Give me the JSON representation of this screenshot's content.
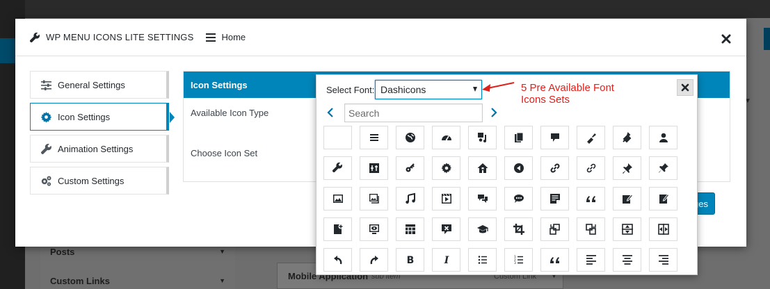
{
  "modal": {
    "title": "WP MENU ICONS LITE SETTINGS",
    "home_label": "Home"
  },
  "tabs": [
    {
      "label": "General Settings",
      "icon": "sliders-icon"
    },
    {
      "label": "Icon Settings",
      "icon": "gear-icon",
      "active": true
    },
    {
      "label": "Animation Settings",
      "icon": "wrench-icon"
    },
    {
      "label": "Custom Settings",
      "icon": "gears-icon"
    }
  ],
  "panel": {
    "title": "Icon Settings",
    "available_icon_type": "Available Icon Type",
    "choose_icon_set": "Choose Icon Set",
    "save_label": "Save Changes"
  },
  "picker": {
    "font_label": "Select Font:",
    "font_value": "Dashicons",
    "search_placeholder": "Search",
    "icons": [
      "blank",
      "menu-icon",
      "admin-site-icon",
      "dashboard-icon",
      "admin-media-icon",
      "admin-page-icon",
      "admin-comments-icon",
      "admin-appearance-icon",
      "admin-plugins-icon",
      "admin-users-icon",
      "admin-tools-icon",
      "admin-settings-icon",
      "admin-network-icon",
      "admin-generic-icon",
      "admin-home-icon",
      "admin-collapse-icon",
      "admin-links-icon",
      "format-links-icon",
      "admin-post-icon",
      "pin-icon",
      "format-image-icon",
      "format-gallery-icon",
      "format-audio-icon",
      "format-video-icon",
      "format-chat-icon",
      "format-status-icon",
      "format-aside-icon",
      "format-quote-icon",
      "welcome-write-blog-icon",
      "edit-page-icon",
      "welcome-add-page-icon",
      "welcome-view-site-icon",
      "welcome-widgets-icon",
      "welcome-comments-icon",
      "welcome-learn-more-icon",
      "image-crop-icon",
      "image-rotate-left-icon",
      "image-rotate-right-icon",
      "image-flip-vertical-icon",
      "image-flip-horizontal-icon",
      "undo-icon",
      "redo-icon",
      "editor-bold-icon",
      "editor-italic-icon",
      "editor-ul-icon",
      "editor-ol-icon",
      "editor-quote-icon",
      "editor-alignleft-icon",
      "editor-aligncenter-icon",
      "editor-alignright-icon"
    ]
  },
  "annotation": {
    "line1": "5 Pre Available Font",
    "line2": "Icons Sets",
    "color": "#e0201b"
  },
  "background": {
    "menu_items": [
      "Posts",
      "Custom Links"
    ],
    "card_title": "Mobile Application",
    "card_sub": "sub item",
    "card_type": "Custom Link"
  },
  "colors": {
    "accent": "#0085ba"
  }
}
